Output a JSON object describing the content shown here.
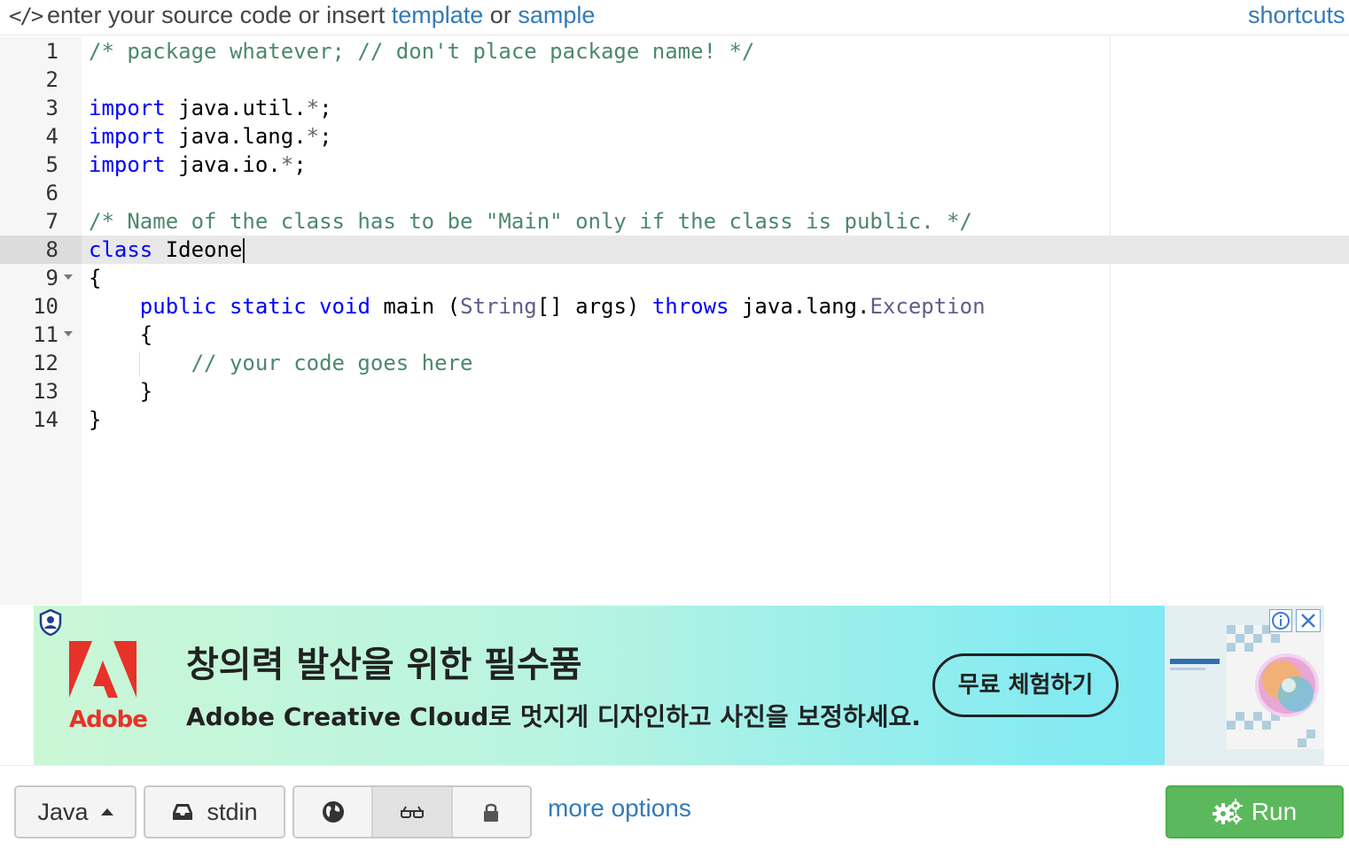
{
  "header": {
    "prompt_prefix": "enter your source code or insert",
    "template_link": "template",
    "or_text": "or",
    "sample_link": "sample",
    "shortcuts_link": "shortcuts",
    "code_icon": "</>"
  },
  "editor": {
    "language_mode": "java",
    "active_line": 8,
    "lines": [
      {
        "n": "1"
      },
      {
        "n": "2"
      },
      {
        "n": "3"
      },
      {
        "n": "4"
      },
      {
        "n": "5"
      },
      {
        "n": "6"
      },
      {
        "n": "7"
      },
      {
        "n": "8"
      },
      {
        "n": "9"
      },
      {
        "n": "10"
      },
      {
        "n": "11"
      },
      {
        "n": "12"
      },
      {
        "n": "13"
      },
      {
        "n": "14"
      }
    ],
    "tokens": {
      "l1_comment": "/* package whatever; // don't place package name! */",
      "l3_kw": "import",
      "l3_a": " java.util.",
      "l3_op": "*",
      "l3_b": ";",
      "l4_kw": "import",
      "l4_a": " java.lang.",
      "l4_op": "*",
      "l4_b": ";",
      "l5_kw": "import",
      "l5_a": " java.io.",
      "l5_op": "*",
      "l5_b": ";",
      "l7_comment": "/* Name of the class has to be \"Main\" only if the class is public. */",
      "l8_kw": "class",
      "l8_a": " Ideone",
      "l9_a": "{",
      "l10_indent": "    ",
      "l10_kw1": "public",
      "l10_kw2": "static",
      "l10_kw3": "void",
      "l10_a": " main (",
      "l10_type": "String",
      "l10_b": "[] args) ",
      "l10_kw4": "throws",
      "l10_c": " java.lang.",
      "l10_type2": "Exception",
      "l11_a": "    {",
      "l12_indent": "        ",
      "l12_comment": "// your code goes here",
      "l13_a": "    }",
      "l14_a": "}"
    }
  },
  "ad": {
    "brand": "Adobe",
    "headline": "창의력 발산을 위한 필수품",
    "subline": "Adobe Creative Cloud로 멋지게 디자인하고 사진을 보정하세요.",
    "cta": "무료 체험하기",
    "info_icon": "info-icon",
    "close_icon": "close-icon"
  },
  "toolbar": {
    "language": "Java",
    "stdin": "stdin",
    "more_options": "more options",
    "run": "Run",
    "visibility_icons": [
      "globe-icon",
      "glasses-icon",
      "lock-icon"
    ],
    "active_visibility": "glasses-icon"
  },
  "colors": {
    "keyword": "#0000ff",
    "comment": "#4c886b",
    "link": "#337ab7",
    "run_button": "#5cb85c"
  }
}
